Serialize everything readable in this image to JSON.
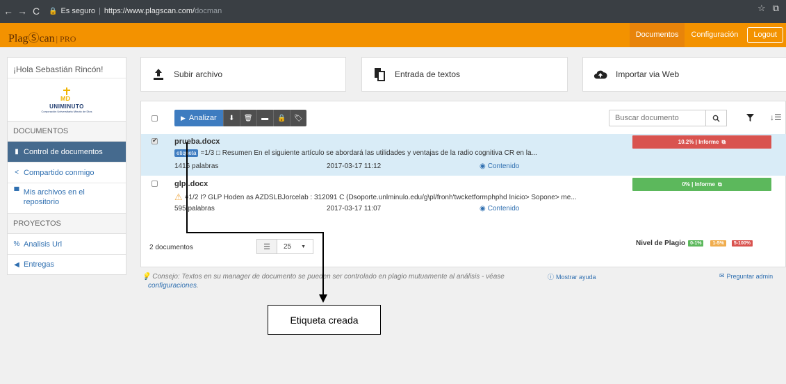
{
  "browser": {
    "secure_label": "Es seguro",
    "url_base": "https://www.plagscan.com/",
    "url_path": "docman"
  },
  "header": {
    "logo_text": "PlagⓈcan",
    "logo_suffix": "| PRO",
    "nav": {
      "documentos": "Documentos",
      "configuracion": "Configuración",
      "logout": "Logout"
    }
  },
  "sidebar": {
    "greeting": "¡Hola Sebastián Rincón!",
    "brand_name": "UNIMINUTO",
    "brand_sub": "Corporación Universitaria Minuto de Dios",
    "sections": {
      "documentos": "DOCUMENTOS",
      "proyectos": "PROYECTOS"
    },
    "items": {
      "control": "Control de documentos",
      "compartido": "Compartido conmigo",
      "mis_archivos": "Mis archivos en el repositorio",
      "analisis": "Analisis Url",
      "entregas": "Entregas"
    }
  },
  "cards": {
    "subir": "Subir archivo",
    "entrada": "Entrada de textos",
    "importar": "Importar via Web"
  },
  "toolbar": {
    "analizar": "Analizar",
    "search_placeholder": "Buscar documento"
  },
  "documents": [
    {
      "title": "prueba.docx",
      "tag": "etiqueta",
      "snippet": "=1/3 □ Resumen En el siguiente artículo se abordará las utilidades y ventajas de la radio cognitiva CR en la...",
      "words": "1416 palabras",
      "date": "2017-03-17 11:12",
      "content_link": "Contenido",
      "score": "10.2% | Informe",
      "score_color": "#d9534f"
    },
    {
      "title": "glpi.docx",
      "snippet": "=1/2 I? GLP Hoden as AZDSLBJorcelab : 312091 C (Dsoporte.unlminulo.edu/g\\pl/fronh'twcketformphphd Inicio> Sopone> me...",
      "words": "595 palabras",
      "date": "2017-03-17 11:07",
      "content_link": "Contenido",
      "score": "0% | Informe",
      "score_color": "#5cb85c"
    }
  ],
  "footer": {
    "doc_count": "2 documentos",
    "page_size": "25",
    "level_label": "Nivel de Plagio",
    "levels": [
      {
        "label": "0-1%",
        "color": "#5cb85c"
      },
      {
        "label": "1-5%",
        "color": "#f0ad4e"
      },
      {
        "label": "5-100%",
        "color": "#d9534f"
      }
    ]
  },
  "tip": {
    "text": "Consejo: Textos en su manager de documento se pueden ser controlado en plagio mutuamente al análisis - véase",
    "link": "configuraciones",
    "end": ".",
    "help": "Mostrar ayuda",
    "admin": "Preguntar admin"
  },
  "annotation": {
    "label": "Etiqueta creada"
  }
}
